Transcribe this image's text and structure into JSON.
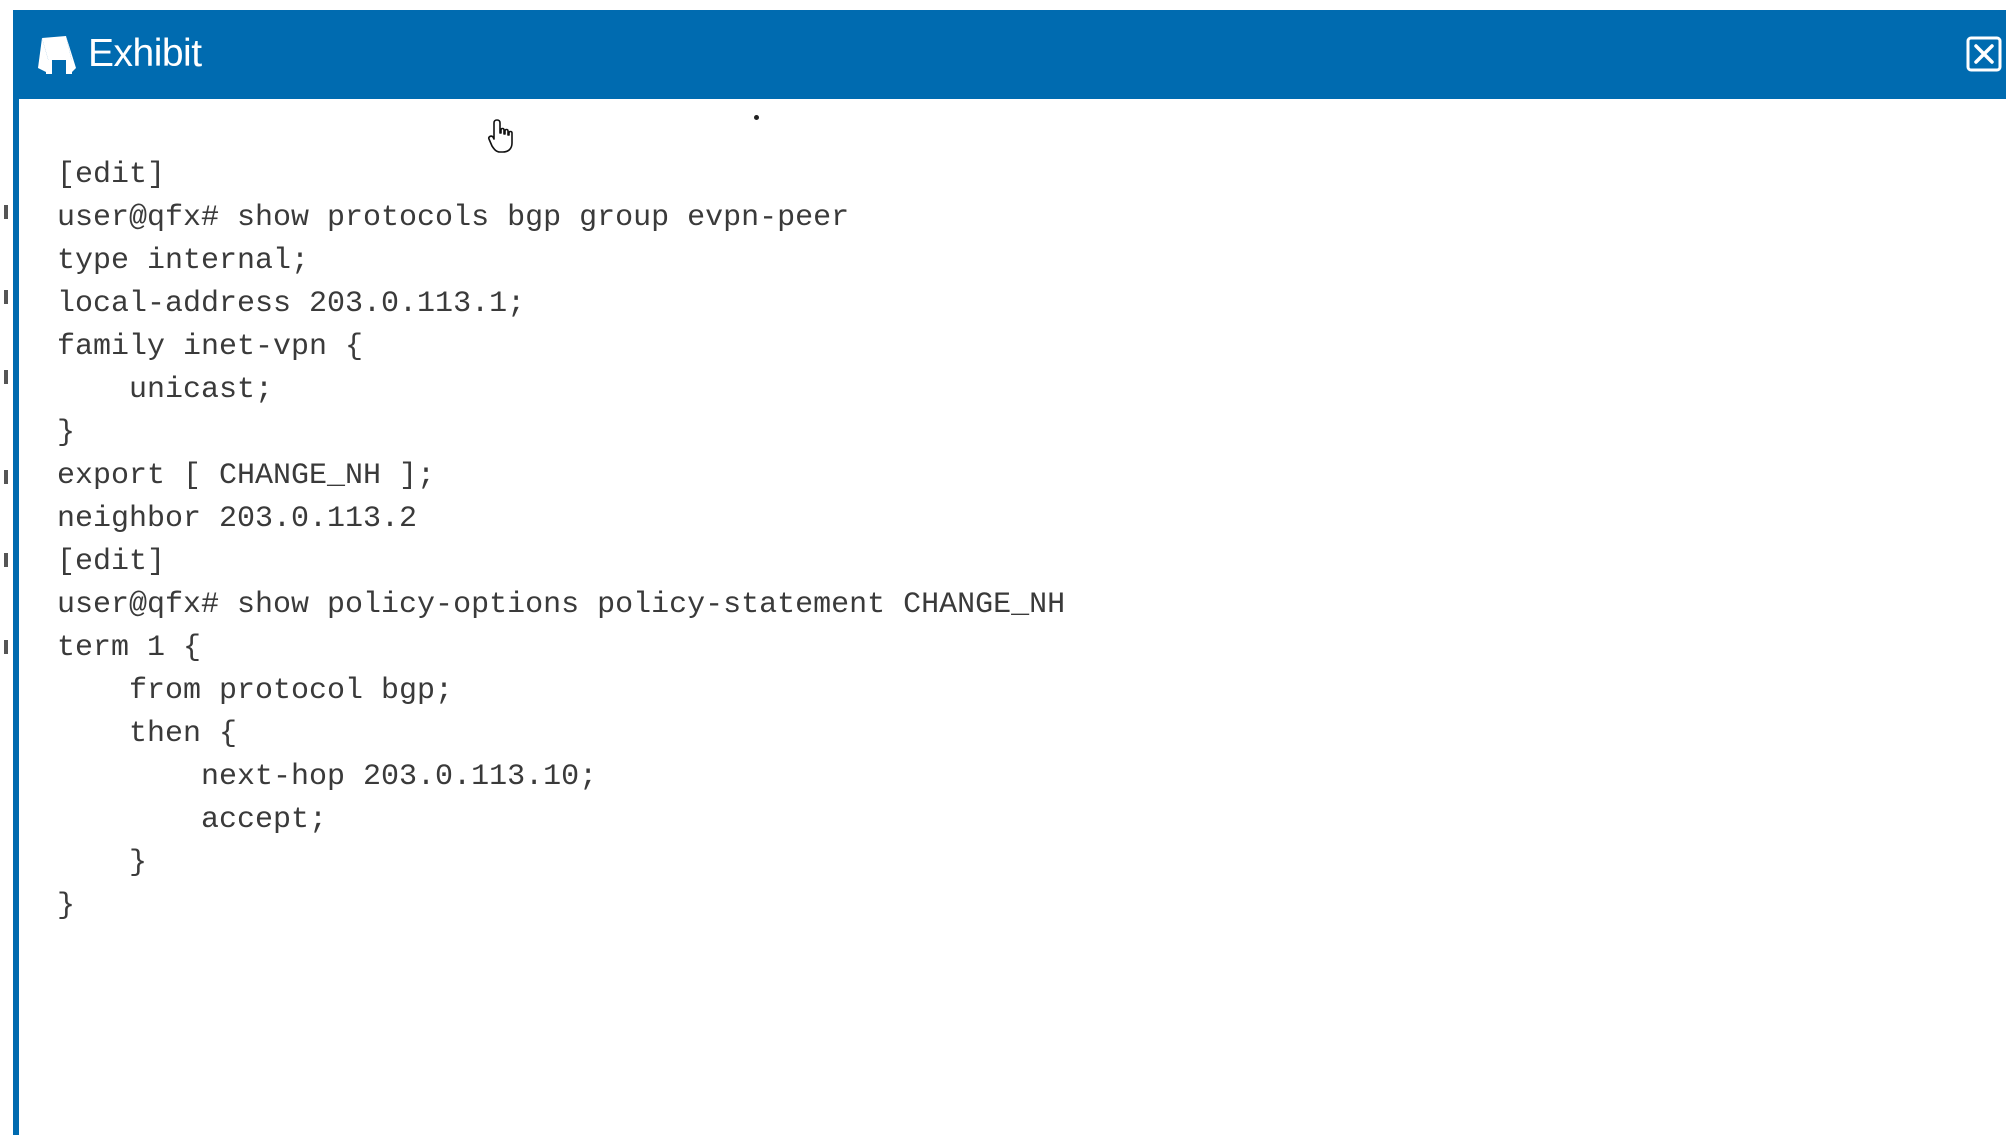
{
  "window": {
    "title": "Exhibit",
    "title_icon": "book-reader-icon",
    "close_icon": "close-box-icon",
    "accent_color": "#006bb0"
  },
  "code_lines": [
    "[edit]",
    "user@qfx# show protocols bgp group evpn-peer",
    "type internal;",
    "local-address 203.0.113.1;",
    "family inet-vpn {",
    "    unicast;",
    "}",
    "export [ CHANGE_NH ];",
    "neighbor 203.0.113.2",
    "[edit]",
    "user@qfx# show policy-options policy-statement CHANGE_NH",
    "term 1 {",
    "    from protocol bgp;",
    "    then {",
    "        next-hop 203.0.113.10;",
    "        accept;",
    "    }",
    "}"
  ]
}
